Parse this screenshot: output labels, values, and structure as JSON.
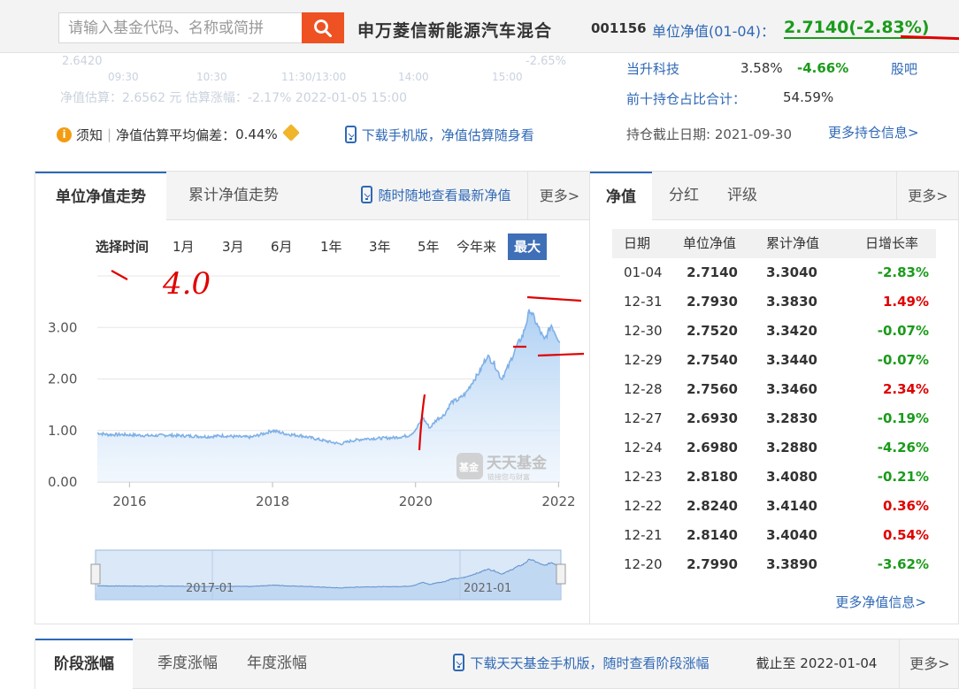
{
  "header": {
    "search_placeholder": "请输入基金代码、名称或简拼",
    "fund_name": "申万菱信新能源汽车混合",
    "fund_code": "001156",
    "nav_label": "单位净值(01-04)：",
    "nav_value": "2.7140(-2.83%)"
  },
  "faded": {
    "v1": "2.6420",
    "t1": "09:30",
    "t2": "10:30",
    "t3": "11:30/13:00",
    "t4": "14:00",
    "t5": "15:00",
    "pct": "-2.65%",
    "estimate_line": "净值估算：2.6562 元  估算涨幅：-2.17% 2022-01-05 15:00"
  },
  "notice": {
    "label": "须知",
    "deviation_label": "净值估算平均偏差：",
    "deviation_value": "0.44%",
    "download": "下载手机版，净值估算随身看"
  },
  "holdings": {
    "rows": [
      {
        "name": "当升科技",
        "weight": "3.58%",
        "change": "-4.66%",
        "link": "股吧"
      }
    ],
    "top10_label": "前十持仓占比合计：",
    "top10_value": "54.59%",
    "date_label": "持仓截止日期: 2021-09-30",
    "more": "更多持仓信息>"
  },
  "trend_panel": {
    "tabs": [
      "单位净值走势",
      "累计净值走势"
    ],
    "app_link": "随时随地查看最新净值",
    "more": "更多>",
    "range_title": "选择时间",
    "ranges": [
      "1月",
      "3月",
      "6月",
      "1年",
      "3年",
      "5年",
      "今年来",
      "最大"
    ],
    "active_range": "最大",
    "watermark": "天天基金",
    "watermark_sub": "链接您与财富",
    "watermark_badge": "基金"
  },
  "chart_data": {
    "type": "area",
    "title": "",
    "xlabel": "",
    "ylabel": "",
    "ylim": [
      0,
      4
    ],
    "yticks": [
      "0.00",
      "1.00",
      "2.00",
      "3.00"
    ],
    "xticks": [
      "2016",
      "2018",
      "2020",
      "2022"
    ],
    "xlim": [
      2015.55,
      2022.02
    ],
    "navigator_labels": [
      "2017-01",
      "2021-01"
    ],
    "x": [
      2015.55,
      2015.7,
      2015.9,
      2016.1,
      2016.3,
      2016.5,
      2016.7,
      2016.9,
      2017.1,
      2017.3,
      2017.5,
      2017.7,
      2017.9,
      2018.0,
      2018.2,
      2018.4,
      2018.6,
      2018.8,
      2018.95,
      2019.1,
      2019.3,
      2019.5,
      2019.7,
      2019.9,
      2020.0,
      2020.1,
      2020.2,
      2020.3,
      2020.4,
      2020.5,
      2020.6,
      2020.7,
      2020.8,
      2020.9,
      2021.0,
      2021.1,
      2021.2,
      2021.3,
      2021.4,
      2021.5,
      2021.6,
      2021.7,
      2021.8,
      2021.9,
      2022.02
    ],
    "y": [
      0.95,
      0.92,
      0.92,
      0.91,
      0.9,
      0.91,
      0.9,
      0.89,
      0.88,
      0.9,
      0.88,
      0.87,
      0.95,
      1.0,
      0.93,
      0.9,
      0.84,
      0.78,
      0.74,
      0.8,
      0.84,
      0.85,
      0.86,
      0.9,
      1.0,
      1.25,
      1.05,
      1.22,
      1.3,
      1.55,
      1.6,
      1.72,
      1.95,
      2.15,
      2.45,
      2.3,
      2.0,
      2.25,
      2.6,
      2.85,
      3.35,
      3.05,
      2.75,
      3.05,
      2.714
    ]
  },
  "nav_table_panel": {
    "tabs": [
      "净值",
      "分红",
      "评级"
    ],
    "more": "更多>",
    "headers": [
      "日期",
      "单位净值",
      "累计净值",
      "日增长率"
    ],
    "rows": [
      {
        "date": "01-04",
        "unit": "2.7140",
        "acc": "3.3040",
        "rate": "-2.83%",
        "color": "#1a9b1a"
      },
      {
        "date": "12-31",
        "unit": "2.7930",
        "acc": "3.3830",
        "rate": "1.49%",
        "color": "#e00000"
      },
      {
        "date": "12-30",
        "unit": "2.7520",
        "acc": "3.3420",
        "rate": "-0.07%",
        "color": "#1a9b1a"
      },
      {
        "date": "12-29",
        "unit": "2.7540",
        "acc": "3.3440",
        "rate": "-0.07%",
        "color": "#1a9b1a"
      },
      {
        "date": "12-28",
        "unit": "2.7560",
        "acc": "3.3460",
        "rate": "2.34%",
        "color": "#e00000"
      },
      {
        "date": "12-27",
        "unit": "2.6930",
        "acc": "3.2830",
        "rate": "-0.19%",
        "color": "#1a9b1a"
      },
      {
        "date": "12-24",
        "unit": "2.6980",
        "acc": "3.2880",
        "rate": "-4.26%",
        "color": "#1a9b1a"
      },
      {
        "date": "12-23",
        "unit": "2.8180",
        "acc": "3.4080",
        "rate": "-0.21%",
        "color": "#1a9b1a"
      },
      {
        "date": "12-22",
        "unit": "2.8240",
        "acc": "3.4140",
        "rate": "0.36%",
        "color": "#e00000"
      },
      {
        "date": "12-21",
        "unit": "2.8140",
        "acc": "3.4040",
        "rate": "0.54%",
        "color": "#e00000"
      },
      {
        "date": "12-20",
        "unit": "2.7990",
        "acc": "3.3890",
        "rate": "-3.62%",
        "color": "#1a9b1a"
      }
    ],
    "more_nav": "更多净值信息>"
  },
  "bottom_panel": {
    "tabs": [
      "阶段涨幅",
      "季度涨幅",
      "年度涨幅"
    ],
    "download": "下载天天基金手机版，随时查看阶段涨幅",
    "as_of": "截止至 2022-01-04",
    "more": "更多>"
  },
  "colors": {
    "accent_blue": "#2e68b6",
    "search_orange": "#ee5223",
    "up_red": "#e00000",
    "down_green": "#1a9b1a",
    "line_blue": "#7fb0e6"
  },
  "annotation_text": "4.0"
}
